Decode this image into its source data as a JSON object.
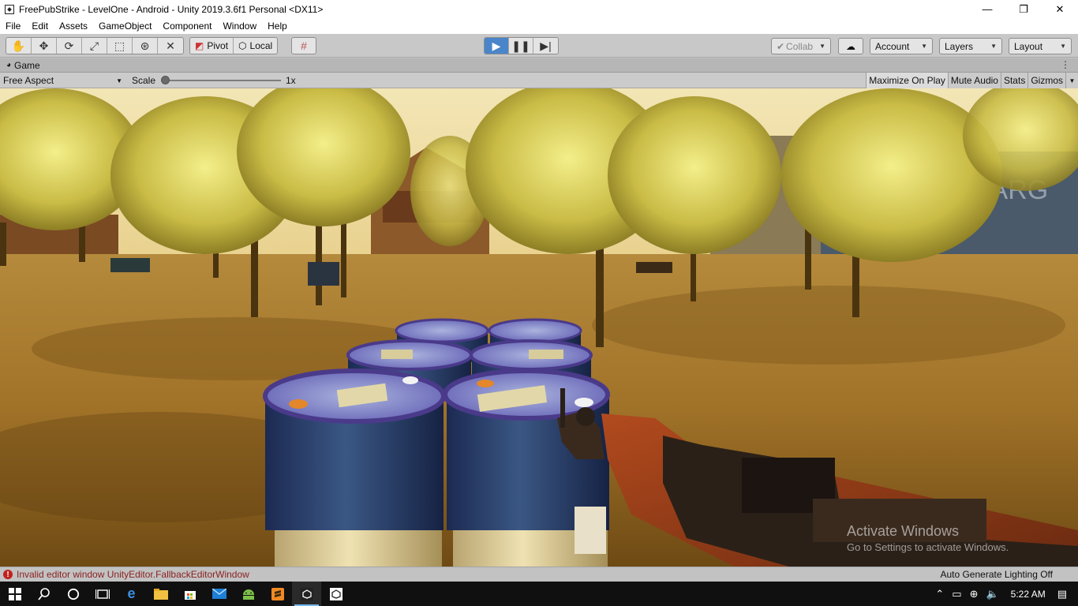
{
  "window": {
    "title": "FreePubStrike - LevelOne - Android - Unity 2019.3.6f1 Personal <DX11>",
    "minimize": "—",
    "maximize": "❐",
    "close": "✕"
  },
  "menu": {
    "items": [
      "File",
      "Edit",
      "Assets",
      "GameObject",
      "Component",
      "Window",
      "Help"
    ]
  },
  "toolbar": {
    "pivot_label": "Pivot",
    "local_label": "Local",
    "collab_label": "Collab",
    "account_label": "Account",
    "layers_label": "Layers",
    "layout_label": "Layout"
  },
  "game_tab": {
    "label": "Game"
  },
  "game_bar": {
    "aspect": "Free Aspect",
    "scale_label": "Scale",
    "scale_value": "1x",
    "scale_level": 0.0,
    "maximize_on_play": "Maximize On Play",
    "mute_audio": "Mute Audio",
    "stats": "Stats",
    "gizmos": "Gizmos"
  },
  "watermark": {
    "title": "Activate Windows",
    "subtitle": "Go to Settings to activate Windows."
  },
  "status": {
    "error_message": "Invalid editor window UnityEditor.FallbackEditorWindow",
    "lighting": "Auto Generate Lighting Off"
  },
  "taskbar": {
    "time": "5:22 AM"
  },
  "colors": {
    "play_active": "#4a85c9",
    "error": "#c0211e",
    "taskbar": "#101010"
  }
}
